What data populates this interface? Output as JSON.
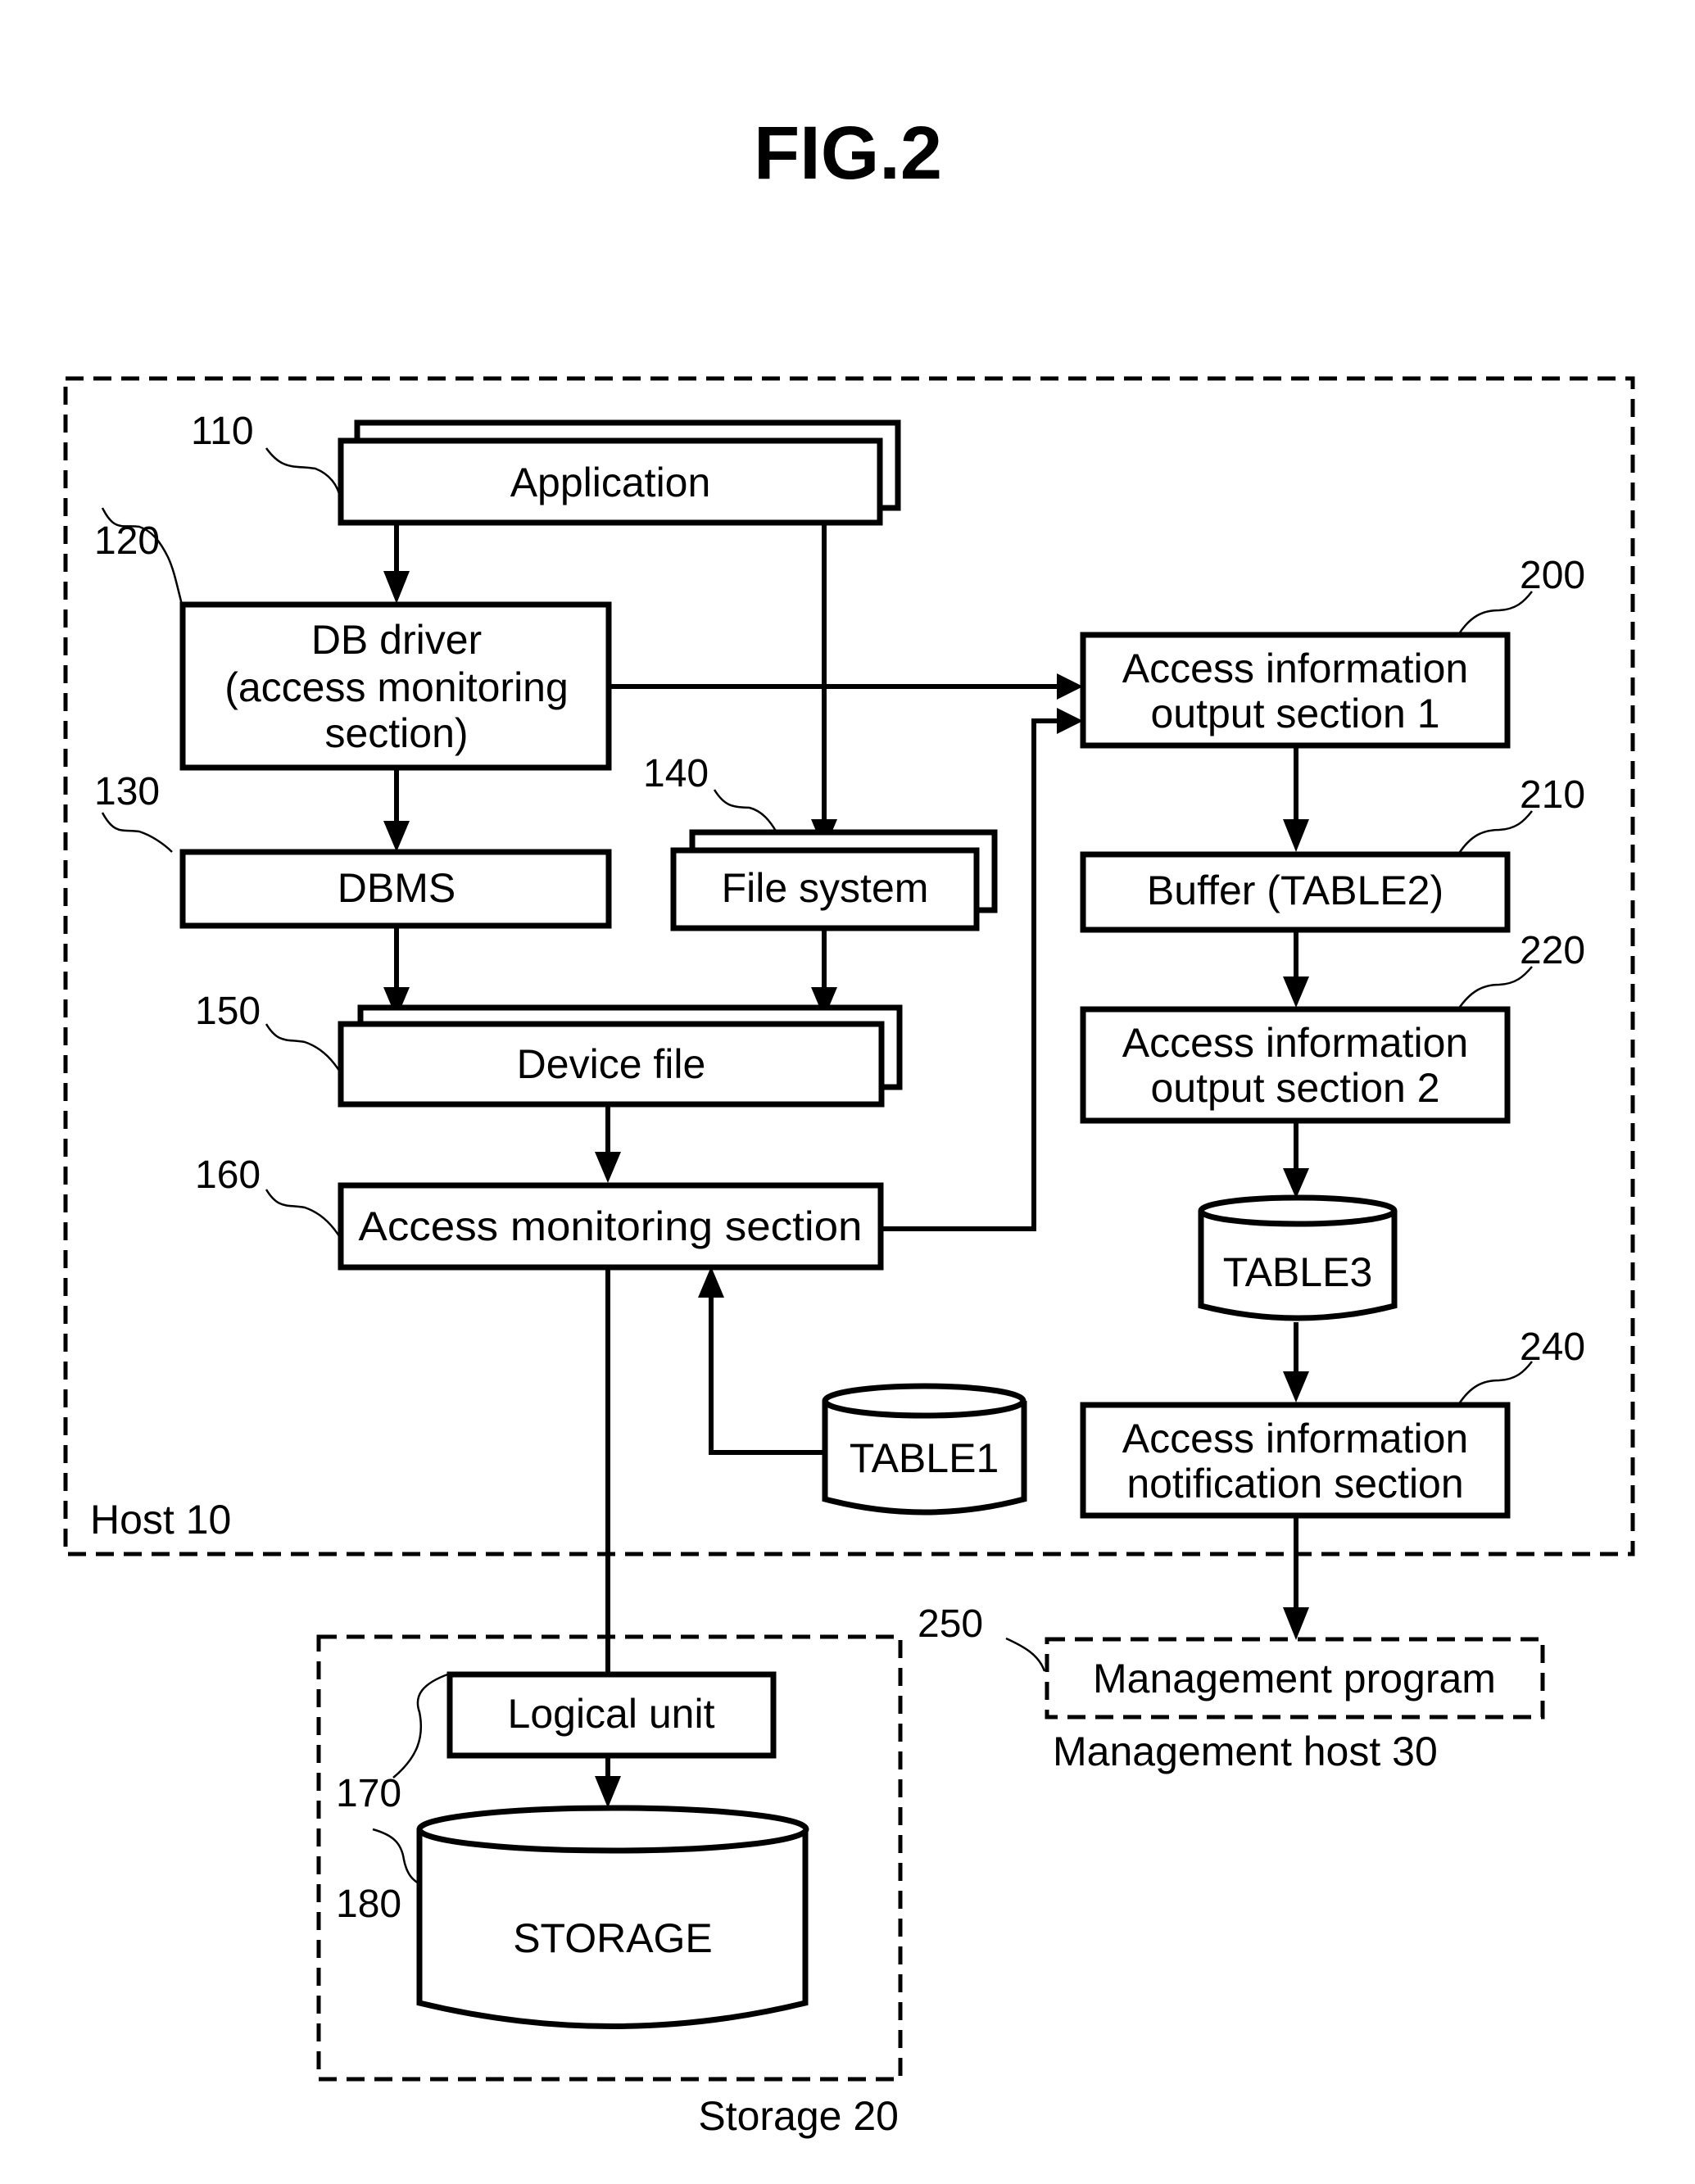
{
  "figure": {
    "title": "FIG.2"
  },
  "containers": {
    "host": {
      "label": "Host 10"
    },
    "storage": {
      "label": "Storage 20"
    },
    "management_host": {
      "label": "Management host 30"
    }
  },
  "blocks": {
    "application": {
      "ref": "110",
      "lines": [
        "Application"
      ]
    },
    "db_driver": {
      "ref": "120",
      "lines": [
        "DB driver",
        "(access monitoring",
        "section)"
      ]
    },
    "dbms": {
      "ref": "130",
      "lines": [
        "DBMS"
      ]
    },
    "file_system": {
      "ref": "140",
      "lines": [
        "File system"
      ]
    },
    "device_file": {
      "ref": "150",
      "lines": [
        "Device file"
      ]
    },
    "access_monitoring": {
      "ref": "160",
      "lines": [
        "Access monitoring section"
      ]
    },
    "table1": {
      "lines": [
        "TABLE1"
      ]
    },
    "logical_unit": {
      "ref": "170",
      "lines": [
        "Logical unit"
      ]
    },
    "storage": {
      "ref": "180",
      "lines": [
        "STORAGE"
      ]
    },
    "output1": {
      "ref": "200",
      "lines": [
        "Access information",
        "output section 1"
      ]
    },
    "buffer": {
      "ref": "210",
      "lines": [
        "Buffer (TABLE2)"
      ]
    },
    "output2": {
      "ref": "220",
      "lines": [
        "Access information",
        "output section 2"
      ]
    },
    "table3": {
      "lines": [
        "TABLE3"
      ]
    },
    "notification": {
      "ref": "240",
      "lines": [
        "Access information",
        "notification section"
      ]
    },
    "management_program": {
      "ref": "250",
      "lines": [
        "Management program"
      ]
    }
  },
  "connections": [
    {
      "from": "application",
      "to": "db_driver"
    },
    {
      "from": "application",
      "to": "file_system"
    },
    {
      "from": "db_driver",
      "to": "dbms"
    },
    {
      "from": "db_driver",
      "to": "output1"
    },
    {
      "from": "dbms",
      "to": "device_file"
    },
    {
      "from": "file_system",
      "to": "device_file"
    },
    {
      "from": "device_file",
      "to": "access_monitoring"
    },
    {
      "from": "table1",
      "to": "access_monitoring"
    },
    {
      "from": "access_monitoring",
      "to": "output1"
    },
    {
      "from": "access_monitoring",
      "to": "logical_unit"
    },
    {
      "from": "logical_unit",
      "to": "storage"
    },
    {
      "from": "output1",
      "to": "buffer"
    },
    {
      "from": "buffer",
      "to": "output2"
    },
    {
      "from": "output2",
      "to": "table3"
    },
    {
      "from": "table3",
      "to": "notification"
    },
    {
      "from": "notification",
      "to": "management_program"
    }
  ]
}
